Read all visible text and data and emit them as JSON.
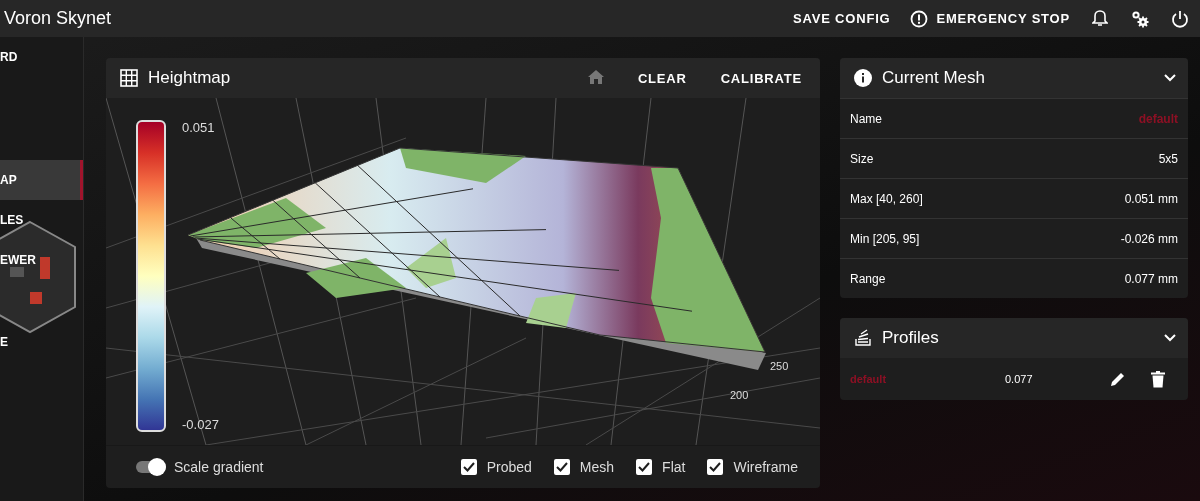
{
  "app_bar": {
    "title": "Voron Skynet",
    "actions": [
      {
        "kind": "text",
        "label": "SAVE CONFIG"
      },
      {
        "kind": "alert",
        "label": "EMERGENCY STOP"
      },
      {
        "kind": "bell"
      },
      {
        "kind": "cogs"
      },
      {
        "kind": "power"
      }
    ]
  },
  "sidebar": {
    "items": [
      {
        "label": "RD",
        "selected": false
      },
      {
        "label": "AP",
        "selected": true
      },
      {
        "label": "LES",
        "selected": false
      },
      {
        "label": "EWER",
        "selected": false
      },
      {
        "label": "E",
        "selected": false
      }
    ]
  },
  "heightmap": {
    "title": "Heightmap",
    "actions": [
      {
        "kind": "home"
      },
      {
        "kind": "text",
        "label": "CLEAR"
      },
      {
        "kind": "text",
        "label": "CALIBRATE"
      }
    ],
    "colorbar": {
      "max": "0.051",
      "min": "-0.027"
    },
    "axis_ticks": [
      "250",
      "200"
    ],
    "scale_gradient": {
      "label": "Scale gradient",
      "on": true
    },
    "options": [
      {
        "label": "Probed",
        "checked": true
      },
      {
        "label": "Mesh",
        "checked": true
      },
      {
        "label": "Flat",
        "checked": true
      },
      {
        "label": "Wireframe",
        "checked": true
      }
    ]
  },
  "current_mesh": {
    "title": "Current Mesh",
    "expanded": true,
    "rows": [
      {
        "label": "Name",
        "value": "default",
        "kind": "accent"
      },
      {
        "label": "Size",
        "value": "5x5",
        "kind": "plain"
      },
      {
        "label": "Max [40, 260]",
        "value": "0.051 mm",
        "kind": "plain"
      },
      {
        "label": "Min [205, 95]",
        "value": "-0.026 mm",
        "kind": "plain"
      },
      {
        "label": "Range",
        "value": "0.077 mm",
        "kind": "plain"
      }
    ]
  },
  "profiles": {
    "title": "Profiles",
    "expanded": true,
    "items": [
      {
        "name": "default",
        "range": "0.077"
      }
    ]
  }
}
